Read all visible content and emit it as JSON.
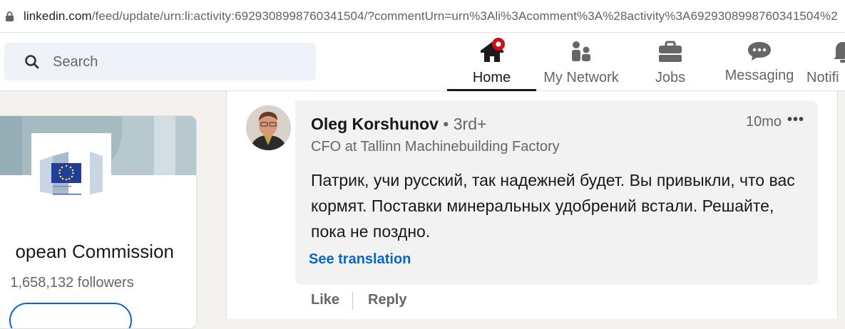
{
  "browser": {
    "url_host": "linkedin.com",
    "url_path": "/feed/update/urn:li:activity:6929308998760341504/?commentUrn=urn%3Ali%3Acomment%3A%28activity%3A6929308998760341504%2"
  },
  "nav": {
    "search_placeholder": "Search",
    "items": [
      {
        "label": "Home",
        "icon": "home-icon",
        "active": true
      },
      {
        "label": "My Network",
        "icon": "network-icon",
        "active": false
      },
      {
        "label": "Jobs",
        "icon": "briefcase-icon",
        "active": false
      },
      {
        "label": "Messaging",
        "icon": "messaging-icon",
        "active": false
      },
      {
        "label": "Notifi",
        "icon": "bell-icon",
        "active": false
      }
    ]
  },
  "company": {
    "name": "opean Commission",
    "followers": "1,658,132 followers",
    "logo_text": "European Commission"
  },
  "comment": {
    "author": "Oleg Korshunov",
    "degree": "• 3rd+",
    "headline": "CFO at Tallinn Machinebuilding Factory",
    "time": "10mo",
    "more": "•••",
    "text": "Патрик, учи русский, так надежней будет. Вы привыкли, что вас кормят. Поставки минеральных удобрений встали. Решайте, пока не поздно.",
    "see_translation": "See translation"
  },
  "actions": {
    "like": "Like",
    "reply": "Reply"
  },
  "colors": {
    "accent": "#0a66c2",
    "notification": "#cc1016"
  }
}
